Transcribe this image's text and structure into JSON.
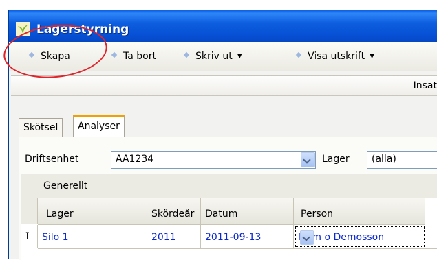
{
  "window": {
    "title": "Lagerstyrning"
  },
  "toolbar": {
    "create_label": "Skapa",
    "delete_label": "Ta bort",
    "print_label": "Skriv ut",
    "show_print_label": "Visa utskrift"
  },
  "strip": {
    "label": "Insat"
  },
  "tabs": [
    {
      "label": "Skötsel"
    },
    {
      "label": "Analyser"
    }
  ],
  "filters": {
    "unit_label": "Driftsenhet",
    "unit_value": "AA1234",
    "storage_label": "Lager",
    "storage_value": "(alla)"
  },
  "grid": {
    "group_label": "Generellt",
    "columns": [
      "Lager",
      "Skördeår",
      "Datum",
      "Person"
    ],
    "row_marker": "I",
    "rows": [
      {
        "lager": "Silo 1",
        "year": "2011",
        "date": "2011-09-13",
        "person": "Dem o Demosson"
      }
    ]
  },
  "colors": {
    "titlebar": "#0650d4",
    "tab_accent": "#f0a000",
    "link_text": "#0a28d0",
    "annotation": "#e0242a"
  }
}
